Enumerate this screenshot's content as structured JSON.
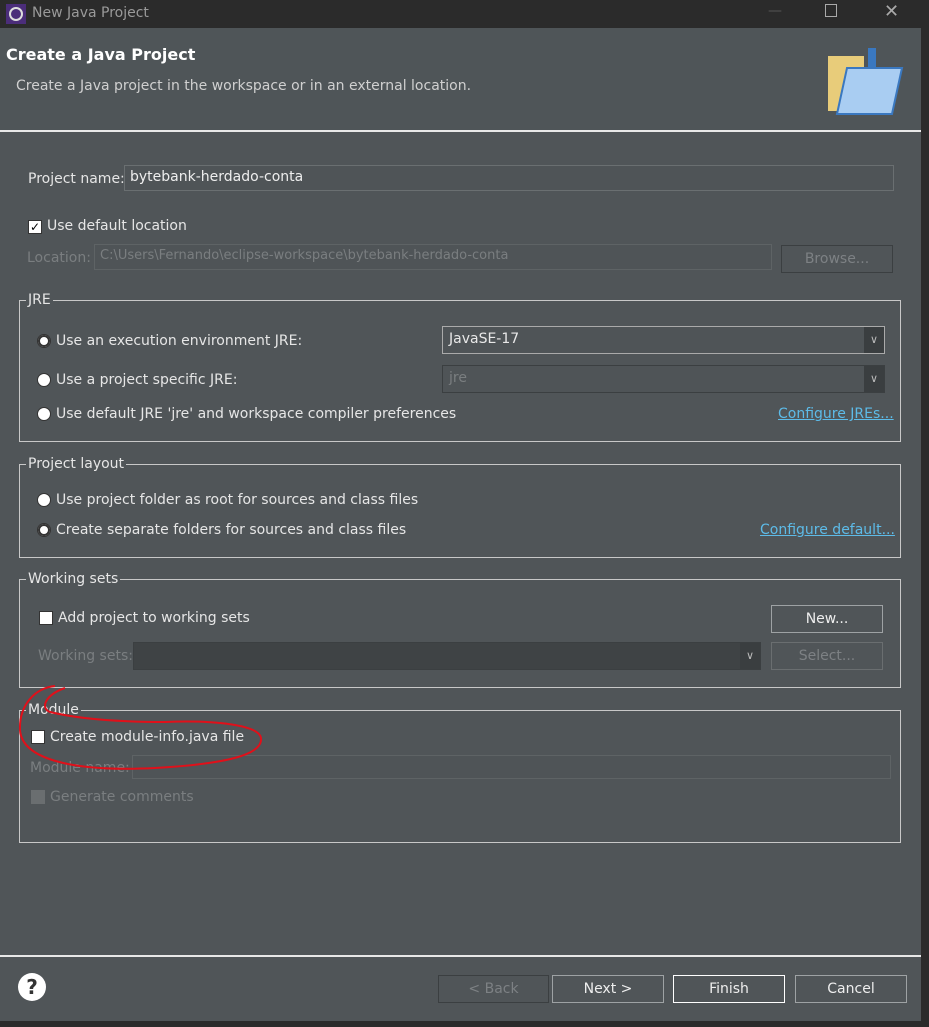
{
  "window": {
    "title": "New Java Project",
    "controls": [
      "minimize",
      "maximize",
      "close"
    ]
  },
  "header": {
    "title": "Create a Java Project",
    "description": "Create a Java project in the workspace or in an external location."
  },
  "project_name": {
    "label": "Project name:",
    "value": "bytebank-herdado-conta"
  },
  "default_location": {
    "label": "Use default location",
    "checked": true
  },
  "location": {
    "label": "Location:",
    "value": "C:\\Users\\Fernando\\eclipse-workspace\\bytebank-herdado-conta",
    "browse": "Browse..."
  },
  "jre": {
    "title": "JRE",
    "option1": "Use an execution environment JRE:",
    "option1_value": "JavaSE-17",
    "option2": "Use a project specific JRE:",
    "option2_value": "jre",
    "option3": "Use default JRE 'jre' and workspace compiler preferences",
    "configure": "Configure JREs...",
    "selected": 1
  },
  "layout": {
    "title": "Project layout",
    "option1": "Use project folder as root for sources and class files",
    "option2": "Create separate folders for sources and class files",
    "configure": "Configure default...",
    "selected": 2
  },
  "working_sets": {
    "title": "Working sets",
    "add_label": "Add project to working sets",
    "checked": false,
    "new": "New...",
    "sets_label": "Working sets:",
    "select": "Select..."
  },
  "module": {
    "title": "Module",
    "create_label": "Create module-info.java file",
    "checked": false,
    "name_label": "Module name:",
    "comments_label": "Generate comments"
  },
  "footer": {
    "back": "< Back",
    "next": "Next >",
    "finish": "Finish",
    "cancel": "Cancel"
  },
  "colors": {
    "annotation": "#e0101a",
    "link": "#5dbbe8"
  }
}
